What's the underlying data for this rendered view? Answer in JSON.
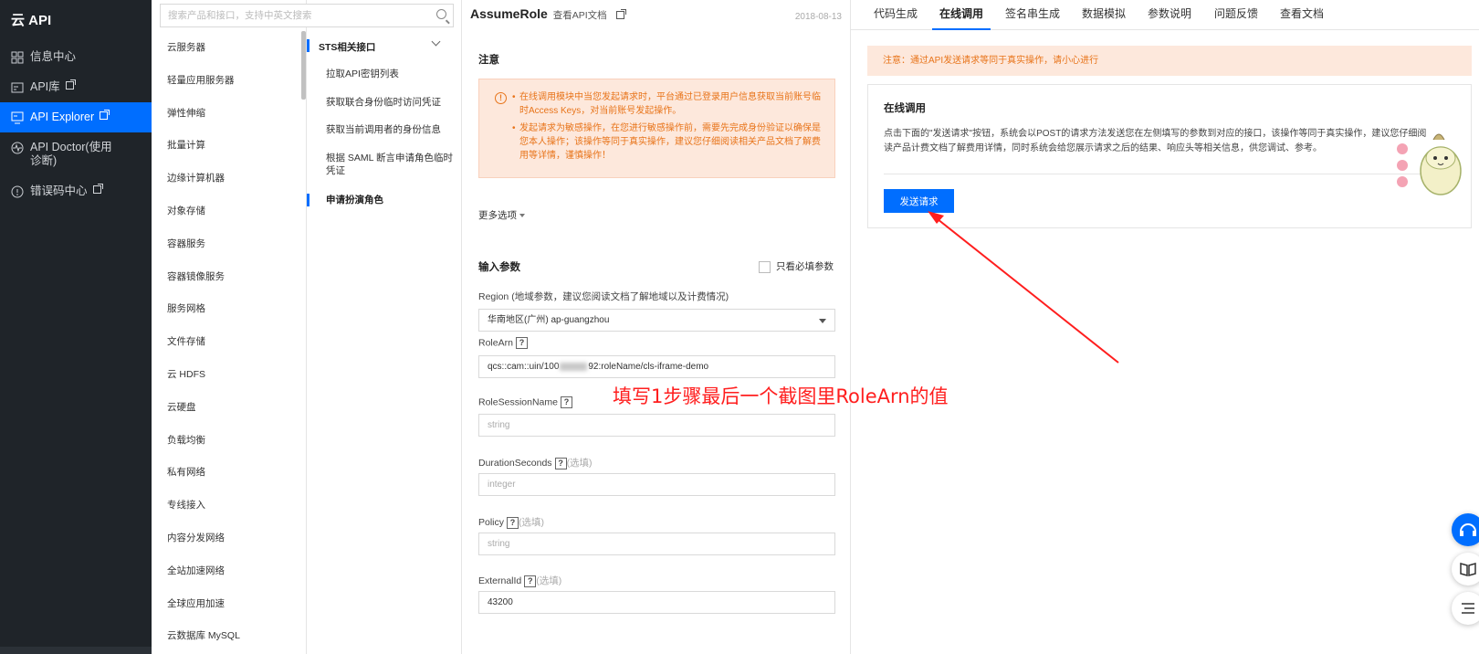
{
  "nav": {
    "title": "云 API",
    "items": [
      {
        "label": "信息中心",
        "icon": "grid-icon",
        "external": false
      },
      {
        "label": "API库",
        "icon": "api-library-icon",
        "external": true
      },
      {
        "label": "API Explorer",
        "icon": "monitor-icon",
        "external": true,
        "active": true
      },
      {
        "label": "API Doctor(使用诊断)",
        "icon": "pulse-icon",
        "external": false
      },
      {
        "label": "错误码中心",
        "icon": "error-circle-icon",
        "external": true
      }
    ]
  },
  "search": {
    "placeholder": "搜索产品和接口，支持中英文搜索"
  },
  "products": [
    "云服务器",
    "轻量应用服务器",
    "弹性伸缩",
    "批量计算",
    "边缘计算机器",
    "对象存储",
    "容器服务",
    "容器镜像服务",
    "服务网格",
    "文件存储",
    "云 HDFS",
    "云硬盘",
    "负载均衡",
    "私有网络",
    "专线接入",
    "内容分发网络",
    "全站加速网络",
    "全球应用加速",
    "云数据库 MySQL"
  ],
  "api_group": {
    "title": "STS相关接口",
    "items": [
      "拉取API密钥列表",
      "获取联合身份临时访问凭证",
      "获取当前调用者的身份信息",
      "根据 SAML 断言申请角色临时凭证",
      "申请扮演角色"
    ],
    "active_index": 4
  },
  "form": {
    "api_name": "AssumeRole",
    "doc_link": "查看API文档",
    "date": "2018-08-13",
    "notice_title": "注意",
    "notice_items": [
      "在线调用模块中当您发起请求时，平台通过已登录用户信息获取当前账号临时Access Keys，对当前账号发起操作。",
      "发起请求为敏感操作，在您进行敏感操作前，需要先完成身份验证以确保是您本人操作；该操作等同于真实操作，建议您仔细阅读相关产品文档了解费用等详情，谨慎操作！"
    ],
    "more_options": "更多选项",
    "input_params": "输入参数",
    "required_only": "只看必填参数",
    "region_label": "Region (地域参数，建议您阅读文档了解地域以及计费情况)",
    "region_value": "华南地区(广州) ap-guangzhou",
    "rolearn_label": "RoleArn",
    "rolearn_prefix": "qcs::cam::uin/100",
    "rolearn_suffix": "92:roleName/cls-iframe-demo",
    "rolesession_label": "RoleSessionName",
    "rolesession_placeholder": "string",
    "duration_label": "DurationSeconds",
    "duration_placeholder": "integer",
    "policy_label": "Policy",
    "policy_placeholder": "string",
    "externalid_label": "ExternalId",
    "externalid_value": "43200",
    "optional_tag": "(选填)",
    "help_mark": "?"
  },
  "right": {
    "tabs": [
      "代码生成",
      "在线调用",
      "签名串生成",
      "数据模拟",
      "参数说明",
      "问题反馈",
      "查看文档"
    ],
    "active_tab": 1,
    "alert": "注意：通过API发送请求等同于真实操作，请小心进行",
    "card_title": "在线调用",
    "card_desc": "点击下面的\"发送请求\"按钮，系统会以POST的请求方法发送您在左侧填写的参数到对应的接口，该操作等同于真实操作，建议您仔细阅读产品计费文档了解费用详情，同时系统会给您展示请求之后的结果、响应头等相关信息，供您调试、参考。",
    "send_button": "发送请求"
  },
  "annotation": {
    "text": "填写1步骤最后一个截图里RoleArn的值",
    "color": "#ff1e1e"
  },
  "colors": {
    "accent": "#006eff",
    "nav_bg": "#1f2429",
    "warning": "#e8741a",
    "notice_bg": "#fde8dc"
  }
}
